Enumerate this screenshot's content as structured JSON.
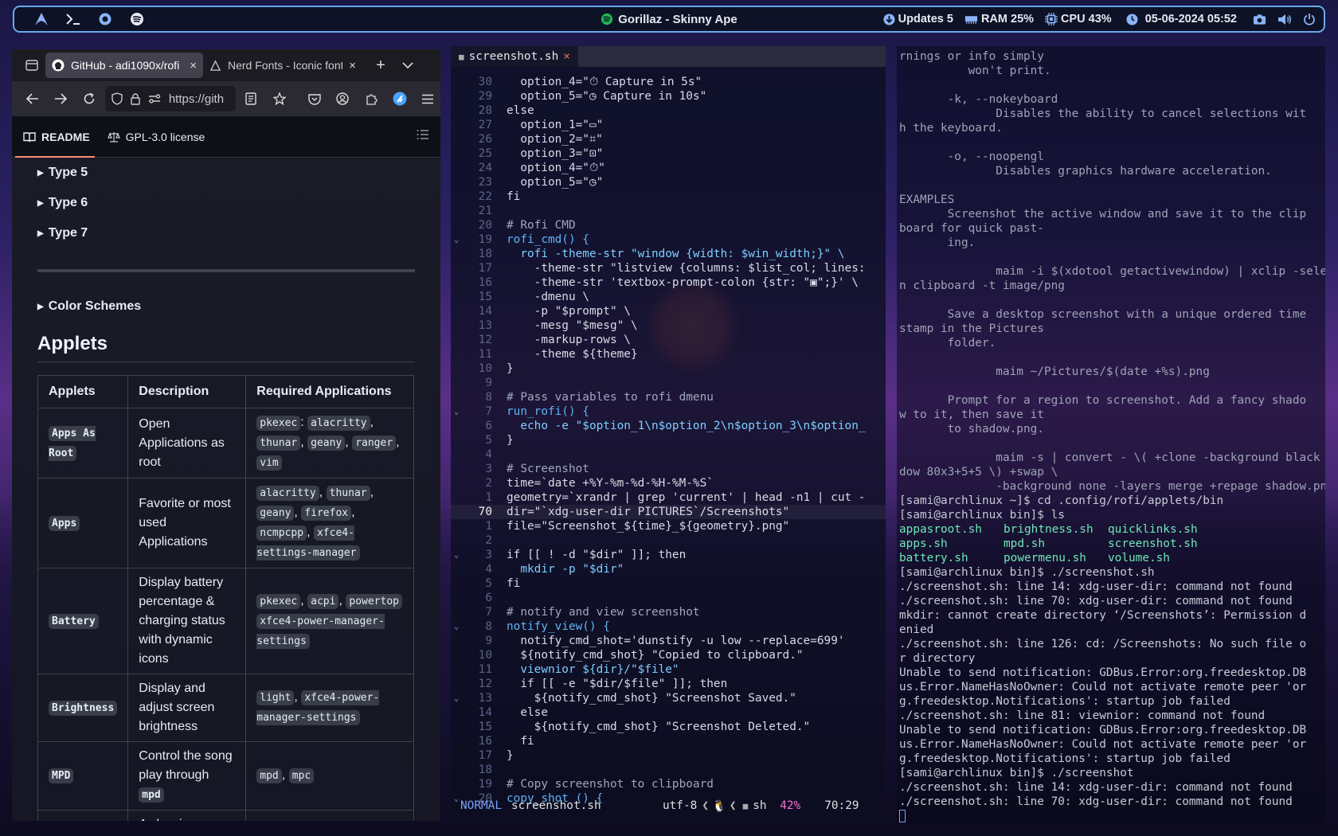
{
  "topbar": {
    "now_playing": "Gorillaz - Skinny Ape",
    "updates": "Updates 5",
    "ram": "RAM 25%",
    "cpu": "CPU 43%",
    "datetime": "05-06-2024 05:52"
  },
  "browser": {
    "tabs": [
      {
        "title": "GitHub - adi1090x/rofi",
        "close": "×"
      },
      {
        "title": "Nerd Fonts - Iconic font",
        "close": "×"
      }
    ],
    "new_tab": "+",
    "url": "https://gith",
    "readme_tab": "README",
    "license_tab": "GPL-3.0 license",
    "sections": [
      "Type 5",
      "Type 6",
      "Type 7"
    ],
    "color_schemes": "Color Schemes",
    "applets_heading": "Applets",
    "table": {
      "headers": [
        "Applets",
        "Description",
        "Required Applications"
      ],
      "rows": [
        {
          "name": "Apps As Root",
          "desc": "Open Applications as root",
          "apps": [
            "pkexec",
            ":",
            "alacritty",
            ",",
            "thunar",
            ",",
            "geany",
            ",",
            "ranger",
            ",",
            "vim"
          ]
        },
        {
          "name": "Apps",
          "desc": "Favorite or most used Applications",
          "apps": [
            "alacritty",
            ",",
            "thunar",
            ",",
            "geany",
            ",",
            "firefox",
            ",",
            "ncmpcpp",
            ",",
            "xfce4-settings-manager"
          ]
        },
        {
          "name": "Battery",
          "desc": "Display battery percentage & charging status with dynamic icons",
          "apps": [
            "pkexec",
            ",",
            "acpi",
            ",",
            "powertop",
            "",
            "xfce4-power-manager-settings"
          ]
        },
        {
          "name": "Brightness",
          "desc": "Display and adjust screen brightness",
          "apps": [
            "light",
            ",",
            "xfce4-power-manager-settings"
          ]
        },
        {
          "name": "MPD",
          "desc": "Control the song play through",
          "desc_code": "mpd",
          "apps": [
            "mpd",
            ",",
            "mpc"
          ]
        },
        {
          "name": "",
          "desc": "A classic power",
          "apps": []
        }
      ]
    }
  },
  "editor": {
    "filename": "screenshot.sh",
    "close": "×",
    "lines": [
      {
        "n": "30",
        "t": "  option_4=\"⏱ Capture in 5s\""
      },
      {
        "n": "29",
        "t": "  option_5=\"◷ Capture in 10s\""
      },
      {
        "n": "28",
        "t": "else"
      },
      {
        "n": "27",
        "t": "  option_1=\"▭\""
      },
      {
        "n": "26",
        "t": "  option_2=\"⌗\""
      },
      {
        "n": "25",
        "t": "  option_3=\"⊡\""
      },
      {
        "n": "24",
        "t": "  option_4=\"⏱\""
      },
      {
        "n": "23",
        "t": "  option_5=\"◷\""
      },
      {
        "n": "22",
        "t": "fi"
      },
      {
        "n": "21",
        "t": ""
      },
      {
        "n": "20",
        "t": "# Rofi CMD"
      },
      {
        "n": "19",
        "t": "rofi_cmd() {"
      },
      {
        "n": "18",
        "t": "  rofi -theme-str \"window {width: $win_width;}\" \\"
      },
      {
        "n": "17",
        "t": "    -theme-str \"listview {columns: $list_col; lines:"
      },
      {
        "n": "16",
        "t": "    -theme-str 'textbox-prompt-colon {str: \"▣\";}' \\"
      },
      {
        "n": "15",
        "t": "    -dmenu \\"
      },
      {
        "n": "14",
        "t": "    -p \"$prompt\" \\"
      },
      {
        "n": "13",
        "t": "    -mesg \"$mesg\" \\"
      },
      {
        "n": "12",
        "t": "    -markup-rows \\"
      },
      {
        "n": "11",
        "t": "    -theme ${theme}"
      },
      {
        "n": "10",
        "t": "}"
      },
      {
        "n": "9",
        "t": ""
      },
      {
        "n": "8",
        "t": "# Pass variables to rofi dmenu"
      },
      {
        "n": "7",
        "t": "run_rofi() {"
      },
      {
        "n": "6",
        "t": "  echo -e \"$option_1\\n$option_2\\n$option_3\\n$option_"
      },
      {
        "n": "5",
        "t": "}"
      },
      {
        "n": "4",
        "t": ""
      },
      {
        "n": "3",
        "t": "# Screenshot"
      },
      {
        "n": "2",
        "t": "time=`date +%Y-%m-%d-%H-%M-%S`"
      },
      {
        "n": "1",
        "t": "geometry=`xrandr | grep 'current' | head -n1 | cut -"
      },
      {
        "n": "70",
        "t": "dir=\"`xdg-user-dir PICTURES`/Screenshots\""
      },
      {
        "n": "1",
        "t": "file=\"Screenshot_${time}_${geometry}.png\""
      },
      {
        "n": "2",
        "t": ""
      },
      {
        "n": "3",
        "t": "if [[ ! -d \"$dir\" ]]; then"
      },
      {
        "n": "4",
        "t": "  mkdir -p \"$dir\""
      },
      {
        "n": "5",
        "t": "fi"
      },
      {
        "n": "6",
        "t": ""
      },
      {
        "n": "7",
        "t": "# notify and view screenshot"
      },
      {
        "n": "8",
        "t": "notify_view() {"
      },
      {
        "n": "9",
        "t": "  notify_cmd_shot='dunstify -u low --replace=699'"
      },
      {
        "n": "10",
        "t": "  ${notify_cmd_shot} \"Copied to clipboard.\""
      },
      {
        "n": "11",
        "t": "  viewnior ${dir}/\"$file\""
      },
      {
        "n": "12",
        "t": "  if [[ -e \"$dir/$file\" ]]; then"
      },
      {
        "n": "13",
        "t": "    ${notify_cmd_shot} \"Screenshot Saved.\""
      },
      {
        "n": "14",
        "t": "  else"
      },
      {
        "n": "15",
        "t": "    ${notify_cmd_shot} \"Screenshot Deleted.\""
      },
      {
        "n": "16",
        "t": "  fi"
      },
      {
        "n": "17",
        "t": "}"
      },
      {
        "n": "18",
        "t": ""
      },
      {
        "n": "19",
        "t": "# Copy screenshot to clipboard"
      },
      {
        "n": "20",
        "t": "copy_shot () {"
      }
    ],
    "status": {
      "mode": "NORMAL",
      "file": "screenshot.sh",
      "encoding": "utf-8",
      "filetype": "sh",
      "percent": "42%",
      "position": "70:29"
    }
  },
  "terminal": {
    "lines": [
      "rnings or info simply",
      "          won't print.",
      "",
      "       -k, --nokeyboard",
      "              Disables the ability to cancel selections wit",
      "h the keyboard.",
      "",
      "       -o, --noopengl",
      "              Disables graphics hardware acceleration.",
      "",
      "EXAMPLES",
      "       Screenshot the active window and save it to the clip",
      "board for quick past-",
      "       ing.",
      "",
      "              maim -i $(xdotool getactivewindow) | xclip -selectio",
      "n clipboard -t image/png",
      "",
      "       Save a desktop screenshot with a unique ordered time",
      "stamp in the Pictures",
      "       folder.",
      "",
      "              maim ~/Pictures/$(date +%s).png",
      "",
      "       Prompt for a region to screenshot. Add a fancy shado",
      "w to it, then save it",
      "       to shadow.png.",
      "",
      "              maim -s | convert - \\( +clone -background black -sha",
      "dow 80x3+5+5 \\) +swap \\",
      "              -background none -layers merge +repage shadow.png",
      "[sami@archlinux ~]$ cd .config/rofi/applets/bin",
      "[sami@archlinux bin]$ ls"
    ],
    "ls_rows": [
      [
        "appasroot.sh",
        "brightness.sh",
        "quicklinks.sh"
      ],
      [
        "apps.sh",
        "mpd.sh",
        "screenshot.sh"
      ],
      [
        "battery.sh",
        "powermenu.sh",
        "volume.sh"
      ]
    ],
    "lines2": [
      "[sami@archlinux bin]$ ./screenshot.sh",
      "./screenshot.sh: line 14: xdg-user-dir: command not found",
      "./screenshot.sh: line 70: xdg-user-dir: command not found",
      "mkdir: cannot create directory ‘/Screenshots’: Permission d",
      "enied",
      "./screenshot.sh: line 126: cd: /Screenshots: No such file o",
      "r directory",
      "Unable to send notification: GDBus.Error:org.freedesktop.DB",
      "us.Error.NameHasNoOwner: Could not activate remote peer 'or",
      "g.freedesktop.Notifications': startup job failed",
      "./screenshot.sh: line 81: viewnior: command not found",
      "Unable to send notification: GDBus.Error:org.freedesktop.DB",
      "us.Error.NameHasNoOwner: Could not activate remote peer 'or",
      "g.freedesktop.Notifications': startup job failed",
      "[sami@archlinux bin]$ ./screenshot",
      "./screenshot.sh: line 14: xdg-user-dir: command not found",
      "./screenshot.sh: line 70: xdg-user-dir: command not found"
    ]
  }
}
